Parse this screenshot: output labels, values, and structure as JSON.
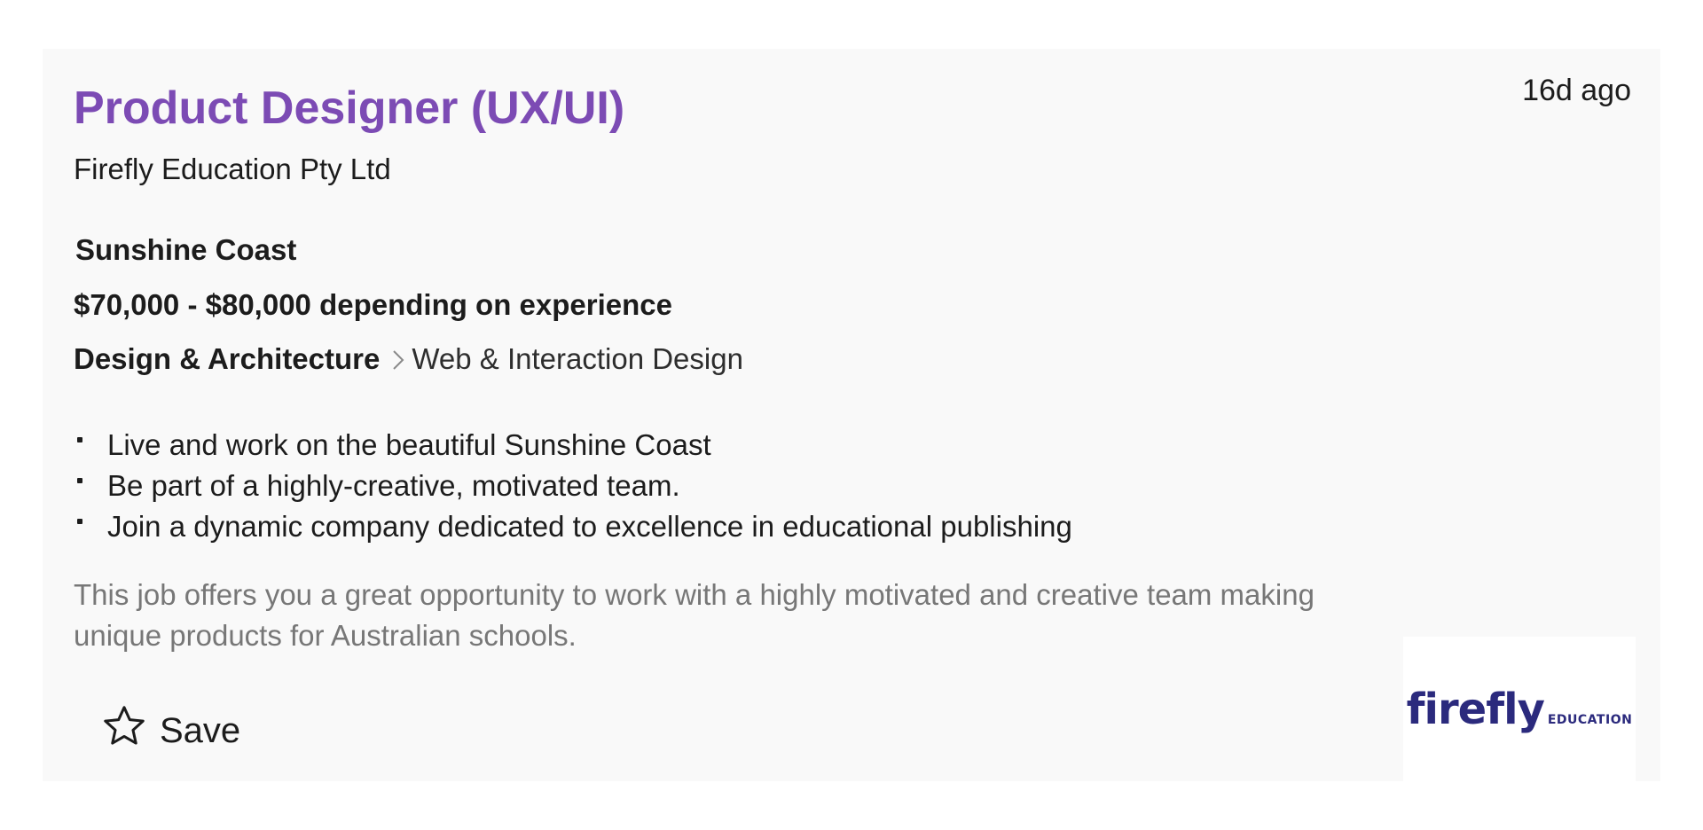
{
  "job": {
    "title": "Product Designer (UX/UI)",
    "listed_ago": "16d ago",
    "company": "Firefly Education Pty Ltd",
    "location": "Sunshine Coast",
    "salary": "$70,000 - $80,000 depending on experience",
    "classification": "Design & Architecture",
    "sub_classification": "Web & Interaction Design",
    "bullets": [
      "Live and work on the beautiful Sunshine Coast",
      "Be part of a highly-creative, motivated team.",
      "Join a dynamic company dedicated to excellence in educational publishing"
    ],
    "teaser": "This job offers you a great opportunity to work with a highly motivated and creative team making unique products for Australian schools.",
    "save_label": "Save",
    "logo": {
      "main": "firefly",
      "sub": "EDUCATION"
    }
  },
  "colors": {
    "title": "#7c4bb4",
    "card_background": "#f9f9f9",
    "teaser_text": "#777777",
    "logo": "#2b2a7d"
  },
  "icons": {
    "save": "star-outline-icon",
    "classification_separator": "chevron-right-icon"
  }
}
